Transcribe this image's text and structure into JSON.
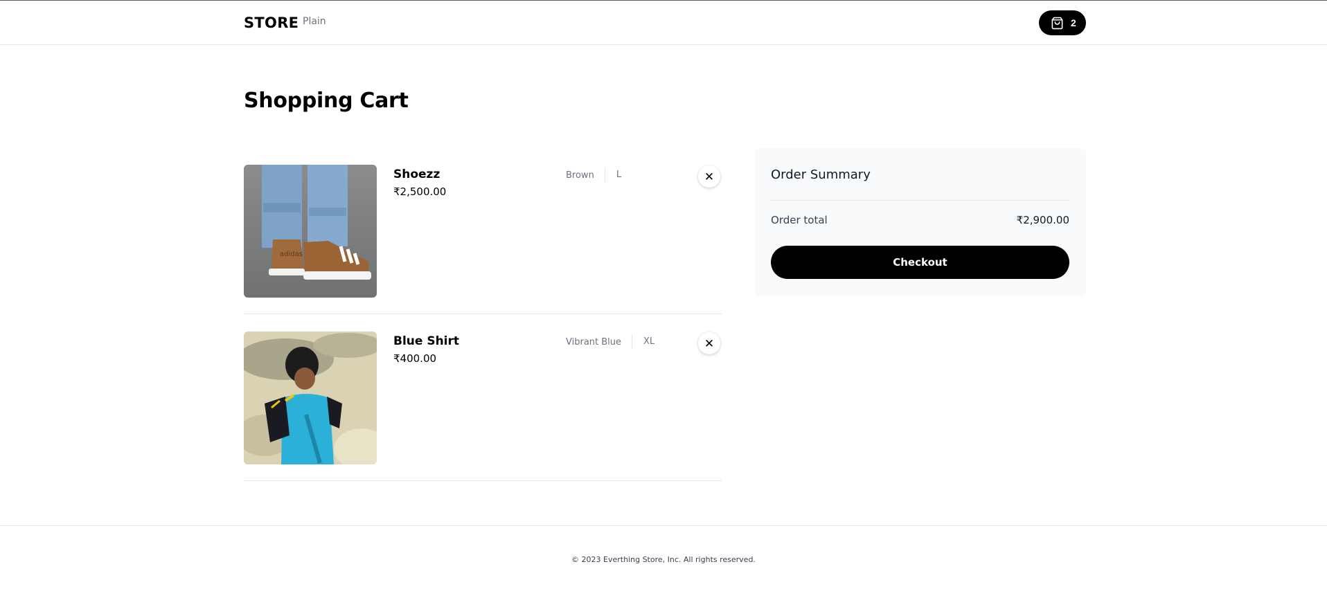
{
  "navbar": {
    "brand": "STORE",
    "links": [
      "Plain"
    ],
    "cart_count": "2",
    "cart_icon": "shopping-bag-icon"
  },
  "page_title": "Shopping Cart",
  "cart": {
    "items": [
      {
        "name": "Shoezz",
        "price": "₹2,500.00",
        "color": "Brown",
        "size": "L",
        "image": "sneakers-photo",
        "remove_icon": "close-icon"
      },
      {
        "name": "Blue Shirt",
        "price": "₹400.00",
        "color": "Vibrant Blue",
        "size": "XL",
        "image": "blue-jersey-photo",
        "remove_icon": "close-icon"
      }
    ]
  },
  "summary": {
    "title": "Order Summary",
    "total_label": "Order total",
    "total_value": "₹2,900.00",
    "checkout_label": "Checkout"
  },
  "footer": {
    "copyright": "© 2023 Everthing Store, Inc. All rights reserved."
  },
  "colors": {
    "accent": "#000000",
    "summary_bg": "#f9fafb",
    "muted_text": "#6b7280",
    "border": "#e5e7eb"
  }
}
